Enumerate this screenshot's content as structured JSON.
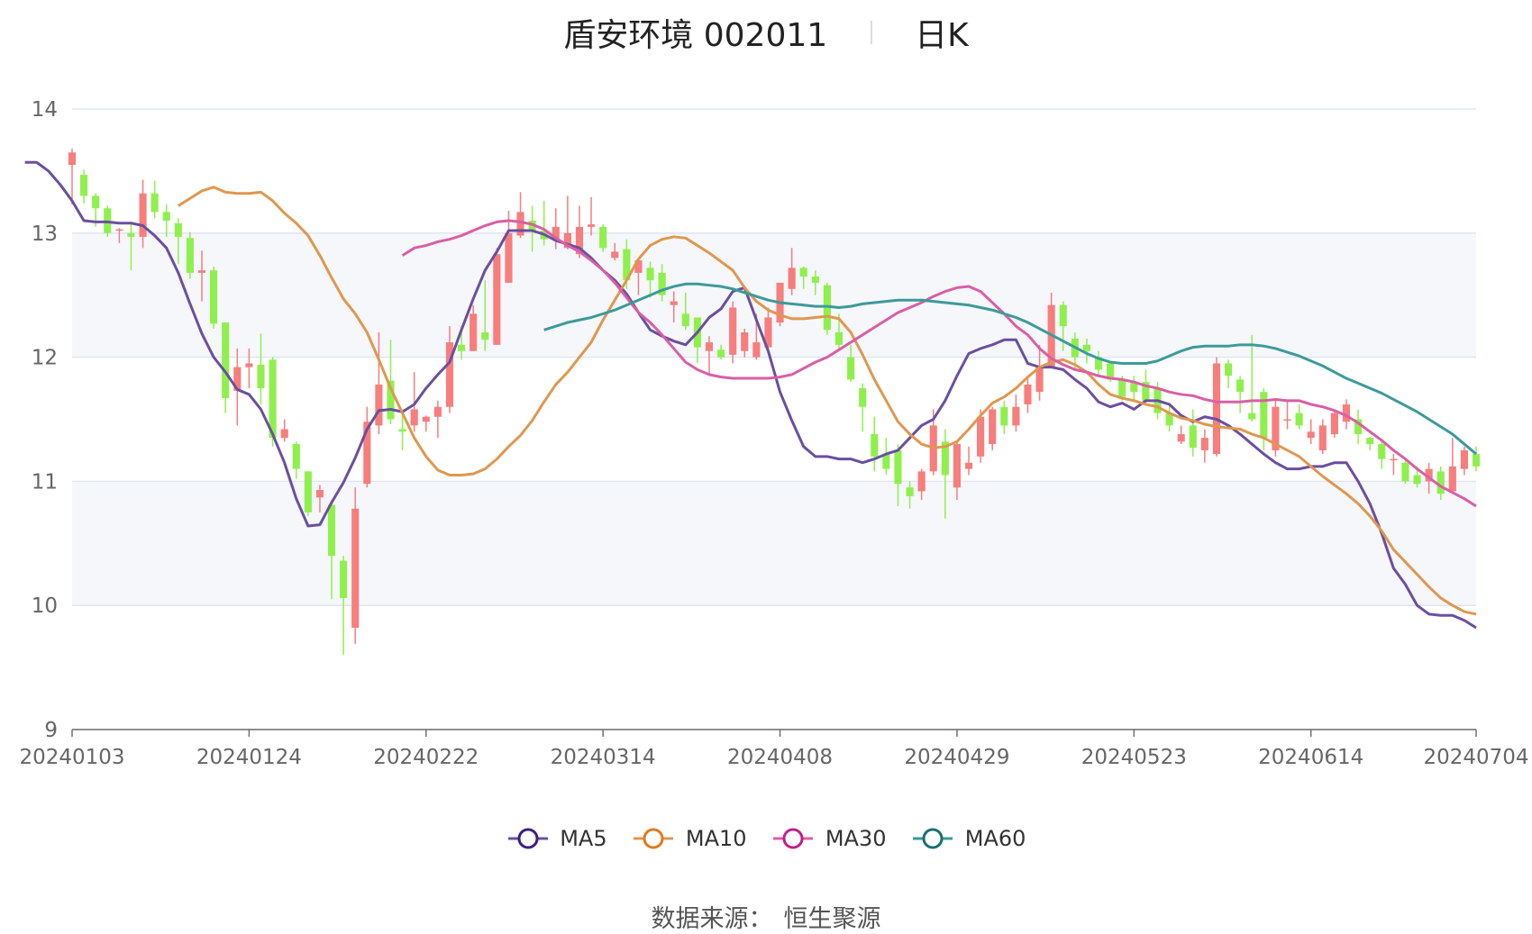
{
  "title": {
    "name": "盾安环境 002011",
    "period": "日K"
  },
  "source": {
    "label": "数据来源：",
    "value": "恒生聚源"
  },
  "chart_data": {
    "type": "candlestick",
    "y_range": [
      9,
      14
    ],
    "y_ticks": [
      9,
      10,
      11,
      12,
      13,
      14
    ],
    "x_tick_labels": [
      "20240103",
      "20240124",
      "20240222",
      "20240314",
      "20240408",
      "20240429",
      "20240523",
      "20240614",
      "20240704"
    ],
    "x_tick_indices": [
      0,
      15,
      30,
      45,
      60,
      75,
      90,
      105,
      119
    ],
    "candle_count": 120,
    "colors": {
      "up": "#f87d7d",
      "down": "#8ff04d",
      "grid": "#e1e6f2",
      "band": "#f5f7fb",
      "axis": "#666666"
    },
    "candles": [
      [
        13.55,
        13.65,
        13.68,
        13.23
      ],
      [
        13.47,
        13.3,
        13.51,
        13.24
      ],
      [
        13.3,
        13.2,
        13.32,
        13.05
      ],
      [
        13.2,
        13.0,
        13.22,
        12.97
      ],
      [
        13.02,
        13.03,
        13.04,
        12.92
      ],
      [
        13.0,
        12.97,
        13.08,
        12.7
      ],
      [
        12.97,
        13.32,
        13.43,
        12.88
      ],
      [
        13.32,
        13.17,
        13.42,
        13.12
      ],
      [
        13.17,
        13.1,
        13.23,
        12.97
      ],
      [
        13.08,
        12.97,
        13.12,
        12.75
      ],
      [
        12.96,
        12.68,
        13.01,
        12.63
      ],
      [
        12.68,
        12.7,
        12.86,
        12.45
      ],
      [
        12.7,
        12.27,
        12.73,
        12.23
      ],
      [
        12.28,
        11.67,
        12.28,
        11.55
      ],
      [
        11.73,
        11.92,
        12.07,
        11.45
      ],
      [
        11.92,
        11.95,
        12.07,
        11.75
      ],
      [
        11.94,
        11.75,
        12.19,
        11.62
      ],
      [
        11.98,
        11.35,
        12.0,
        11.28
      ],
      [
        11.35,
        11.42,
        11.5,
        11.32
      ],
      [
        11.3,
        11.1,
        11.32,
        11.02
      ],
      [
        11.08,
        10.75,
        11.08,
        10.72
      ],
      [
        10.87,
        10.93,
        10.97,
        10.75
      ],
      [
        10.81,
        10.4,
        10.85,
        10.05
      ],
      [
        10.36,
        10.06,
        10.4,
        9.6
      ],
      [
        9.82,
        10.78,
        10.95,
        9.69
      ],
      [
        10.98,
        11.48,
        11.6,
        10.95
      ],
      [
        11.45,
        11.78,
        12.2,
        11.38
      ],
      [
        11.81,
        11.5,
        12.14,
        11.46
      ],
      [
        11.42,
        11.4,
        11.58,
        11.25
      ],
      [
        11.45,
        11.58,
        11.88,
        11.4
      ],
      [
        11.48,
        11.52,
        11.53,
        11.4
      ],
      [
        11.52,
        11.6,
        11.65,
        11.35
      ],
      [
        11.6,
        12.12,
        12.25,
        11.55
      ],
      [
        12.1,
        12.05,
        12.25,
        11.98
      ],
      [
        12.05,
        12.35,
        12.42,
        12.05
      ],
      [
        12.2,
        12.14,
        12.62,
        12.05
      ],
      [
        12.1,
        12.83,
        12.88,
        12.1
      ],
      [
        12.6,
        13.0,
        13.18,
        12.6
      ],
      [
        12.98,
        13.17,
        13.33,
        12.96
      ],
      [
        13.1,
        13.02,
        13.22,
        12.85
      ],
      [
        13.02,
        12.95,
        13.26,
        12.9
      ],
      [
        12.95,
        13.05,
        13.2,
        12.87
      ],
      [
        12.88,
        13.0,
        13.3,
        12.87
      ],
      [
        12.83,
        13.05,
        13.22,
        12.8
      ],
      [
        13.05,
        13.07,
        13.29,
        12.98
      ],
      [
        13.05,
        12.88,
        13.07,
        12.85
      ],
      [
        12.8,
        12.85,
        12.92,
        12.78
      ],
      [
        12.87,
        12.62,
        12.95,
        12.55
      ],
      [
        12.68,
        12.78,
        12.8,
        12.5
      ],
      [
        12.72,
        12.62,
        12.77,
        12.48
      ],
      [
        12.68,
        12.5,
        12.75,
        12.45
      ],
      [
        12.42,
        12.45,
        12.53,
        12.28
      ],
      [
        12.35,
        12.25,
        12.52,
        12.22
      ],
      [
        12.32,
        12.08,
        12.32,
        11.95
      ],
      [
        12.05,
        12.12,
        12.17,
        11.85
      ],
      [
        12.06,
        12.0,
        12.1,
        11.98
      ],
      [
        12.02,
        12.4,
        12.45,
        11.95
      ],
      [
        12.05,
        12.2,
        12.23,
        12.0
      ],
      [
        12.0,
        12.12,
        12.35,
        11.98
      ],
      [
        12.08,
        12.32,
        12.4,
        12.05
      ],
      [
        12.28,
        12.6,
        12.6,
        12.25
      ],
      [
        12.55,
        12.72,
        12.88,
        12.5
      ],
      [
        12.72,
        12.65,
        12.73,
        12.55
      ],
      [
        12.65,
        12.6,
        12.7,
        12.5
      ],
      [
        12.58,
        12.22,
        12.6,
        12.18
      ],
      [
        12.2,
        12.1,
        12.35,
        12.05
      ],
      [
        12.0,
        11.82,
        12.1,
        11.8
      ],
      [
        11.75,
        11.6,
        11.79,
        11.4
      ],
      [
        11.38,
        11.2,
        11.52,
        11.08
      ],
      [
        11.22,
        11.1,
        11.35,
        11.05
      ],
      [
        11.25,
        10.98,
        11.3,
        10.8
      ],
      [
        10.95,
        10.88,
        11.0,
        10.78
      ],
      [
        10.92,
        11.08,
        11.1,
        10.85
      ],
      [
        11.08,
        11.45,
        11.58,
        11.05
      ],
      [
        11.32,
        11.05,
        11.42,
        10.7
      ],
      [
        10.95,
        11.3,
        11.33,
        10.85
      ],
      [
        11.1,
        11.15,
        11.28,
        11.05
      ],
      [
        11.2,
        11.52,
        11.58,
        11.15
      ],
      [
        11.3,
        11.58,
        11.6,
        11.25
      ],
      [
        11.6,
        11.45,
        11.65,
        11.38
      ],
      [
        11.45,
        11.6,
        11.7,
        11.4
      ],
      [
        11.62,
        11.78,
        11.85,
        11.55
      ],
      [
        11.72,
        11.92,
        12.1,
        11.65
      ],
      [
        11.92,
        12.42,
        12.52,
        11.92
      ],
      [
        12.42,
        12.25,
        12.45,
        12.05
      ],
      [
        12.15,
        12.0,
        12.2,
        11.9
      ],
      [
        12.1,
        12.05,
        12.15,
        11.95
      ],
      [
        12.0,
        11.9,
        12.05,
        11.85
      ],
      [
        11.95,
        11.82,
        11.95,
        11.8
      ],
      [
        11.82,
        11.68,
        11.85,
        11.65
      ],
      [
        11.8,
        11.72,
        11.85,
        11.65
      ],
      [
        11.8,
        11.65,
        11.9,
        11.63
      ],
      [
        11.75,
        11.55,
        11.8,
        11.5
      ],
      [
        11.55,
        11.45,
        11.62,
        11.4
      ],
      [
        11.32,
        11.38,
        11.45,
        11.3
      ],
      [
        11.45,
        11.27,
        11.58,
        11.2
      ],
      [
        11.25,
        11.35,
        11.42,
        11.15
      ],
      [
        11.22,
        11.95,
        12.0,
        11.2
      ],
      [
        11.95,
        11.85,
        11.98,
        11.75
      ],
      [
        11.82,
        11.72,
        11.85,
        11.55
      ],
      [
        11.55,
        11.5,
        12.18,
        11.48
      ],
      [
        11.72,
        11.35,
        11.75,
        11.25
      ],
      [
        11.25,
        11.6,
        11.65,
        11.2
      ],
      [
        11.5,
        11.5,
        11.65,
        11.42
      ],
      [
        11.55,
        11.45,
        11.62,
        11.42
      ],
      [
        11.35,
        11.4,
        11.5,
        11.3
      ],
      [
        11.25,
        11.45,
        11.5,
        11.22
      ],
      [
        11.38,
        11.55,
        11.58,
        11.35
      ],
      [
        11.48,
        11.62,
        11.66,
        11.42
      ],
      [
        11.5,
        11.38,
        11.58,
        11.3
      ],
      [
        11.35,
        11.3,
        11.36,
        11.25
      ],
      [
        11.3,
        11.18,
        11.32,
        11.1
      ],
      [
        11.18,
        11.18,
        11.22,
        11.05
      ],
      [
        11.15,
        11.0,
        11.18,
        10.98
      ],
      [
        11.05,
        10.98,
        11.12,
        10.95
      ],
      [
        11.0,
        11.1,
        11.15,
        10.9
      ],
      [
        11.08,
        10.9,
        11.12,
        10.85
      ],
      [
        10.92,
        11.12,
        11.35,
        10.9
      ],
      [
        11.1,
        11.25,
        11.28,
        11.05
      ],
      [
        11.22,
        11.12,
        11.28,
        11.08
      ]
    ],
    "series": [
      {
        "name": "MA5",
        "color": "#6a4fa0",
        "legend_color": "#3c1f82",
        "values": [
          13.57,
          13.57,
          13.5,
          13.39,
          13.26,
          13.1,
          13.09,
          13.09,
          13.08,
          13.08,
          13.06,
          12.98,
          12.88,
          12.68,
          12.43,
          12.19,
          12.0,
          11.88,
          11.74,
          11.7,
          11.58,
          11.38,
          11.15,
          10.86,
          10.64,
          10.65,
          10.83,
          10.99,
          11.19,
          11.42,
          11.57,
          11.58,
          11.56,
          11.62,
          11.75,
          11.86,
          11.96,
          12.22,
          12.47,
          12.7,
          12.85,
          13.02,
          13.02,
          13.02,
          12.99,
          12.94,
          12.91,
          12.88,
          12.8,
          12.7,
          12.62,
          12.51,
          12.36,
          12.22,
          12.17,
          12.13,
          12.1,
          12.2,
          12.32,
          12.39,
          12.53,
          12.56,
          12.3,
          12.05,
          11.72,
          11.49,
          11.28,
          11.2,
          11.2,
          11.18,
          11.18,
          11.15,
          11.18,
          11.22,
          11.25,
          11.35,
          11.45,
          11.5,
          11.65,
          11.85,
          12.03,
          12.07,
          12.1,
          12.14,
          12.14,
          11.95,
          11.92,
          11.92,
          11.9,
          11.82,
          11.75,
          11.64,
          11.6,
          11.63,
          11.58,
          11.65,
          11.65,
          11.62,
          11.53,
          11.48,
          11.52,
          11.5,
          11.45,
          11.38,
          11.3,
          11.22,
          11.15,
          11.1,
          11.1,
          11.12,
          11.12,
          11.15,
          11.15,
          11.0,
          10.82,
          10.58,
          10.3,
          10.17,
          10.0,
          9.93,
          9.92,
          9.92,
          9.88,
          9.82
        ]
      },
      {
        "name": "MA10",
        "color": "#e0974e",
        "legend_color": "#e07a1e",
        "values": [
          13.22,
          13.28,
          13.34,
          13.37,
          13.33,
          13.32,
          13.32,
          13.33,
          13.26,
          13.16,
          13.08,
          12.98,
          12.82,
          12.64,
          12.47,
          12.35,
          12.2,
          11.98,
          11.75,
          11.55,
          11.35,
          11.2,
          11.09,
          11.05,
          11.05,
          11.06,
          11.1,
          11.18,
          11.28,
          11.37,
          11.49,
          11.64,
          11.78,
          11.88,
          12.0,
          12.12,
          12.3,
          12.46,
          12.62,
          12.79,
          12.9,
          12.95,
          12.97,
          12.96,
          12.9,
          12.84,
          12.77,
          12.7,
          12.56,
          12.45,
          12.38,
          12.34,
          12.31,
          12.31,
          12.32,
          12.33,
          12.31,
          12.2,
          12.02,
          11.82,
          11.65,
          11.48,
          11.38,
          11.3,
          11.27,
          11.28,
          11.32,
          11.42,
          11.53,
          11.63,
          11.68,
          11.75,
          11.84,
          11.92,
          11.96,
          11.98,
          11.94,
          11.88,
          11.78,
          11.7,
          11.67,
          11.65,
          11.62,
          11.6,
          11.55,
          11.51,
          11.49,
          11.46,
          11.44,
          11.43,
          11.42,
          11.38,
          11.35,
          11.3,
          11.25,
          11.2,
          11.12,
          11.04,
          10.97,
          10.9,
          10.82,
          10.72,
          10.6,
          10.45,
          10.35,
          10.25,
          10.15,
          10.06,
          10.0,
          9.95,
          9.93
        ]
      },
      {
        "name": "MA30",
        "color": "#da5ea6",
        "legend_color": "#c0208a",
        "values": [
          12.82,
          12.88,
          12.9,
          12.93,
          12.95,
          12.98,
          13.02,
          13.06,
          13.09,
          13.1,
          13.09,
          13.07,
          13.03,
          12.96,
          12.9,
          12.85,
          12.78,
          12.7,
          12.6,
          12.48,
          12.36,
          12.28,
          12.18,
          12.07,
          11.96,
          11.9,
          11.86,
          11.84,
          11.83,
          11.83,
          11.83,
          11.83,
          11.84,
          11.86,
          11.91,
          11.96,
          12.0,
          12.06,
          12.12,
          12.18,
          12.24,
          12.3,
          12.36,
          12.4,
          12.44,
          12.49,
          12.53,
          12.56,
          12.57,
          12.53,
          12.44,
          12.35,
          12.25,
          12.18,
          12.07,
          11.99,
          11.94,
          11.9,
          11.88,
          11.85,
          11.83,
          11.82,
          11.8,
          11.77,
          11.75,
          11.72,
          11.7,
          11.69,
          11.66,
          11.64,
          11.64,
          11.64,
          11.65,
          11.65,
          11.66,
          11.65,
          11.65,
          11.62,
          11.6,
          11.57,
          11.53,
          11.47,
          11.4,
          11.33,
          11.25,
          11.18,
          11.1,
          11.03,
          10.96,
          10.91,
          10.86,
          10.8
        ]
      },
      {
        "name": "MA60",
        "color": "#3d9a9a",
        "legend_color": "#1a6f72",
        "values": [
          12.22,
          12.25,
          12.28,
          12.3,
          12.32,
          12.35,
          12.38,
          12.42,
          12.46,
          12.5,
          12.54,
          12.57,
          12.59,
          12.59,
          12.58,
          12.57,
          12.55,
          12.52,
          12.49,
          12.46,
          12.44,
          12.43,
          12.42,
          12.41,
          12.41,
          12.4,
          12.41,
          12.43,
          12.44,
          12.45,
          12.46,
          12.46,
          12.46,
          12.45,
          12.44,
          12.43,
          12.42,
          12.4,
          12.38,
          12.35,
          12.32,
          12.28,
          12.23,
          12.18,
          12.13,
          12.08,
          12.03,
          11.99,
          11.96,
          11.95,
          11.95,
          11.95,
          11.97,
          12.01,
          12.05,
          12.08,
          12.09,
          12.09,
          12.09,
          12.1,
          12.1,
          12.09,
          12.07,
          12.04,
          12.01,
          11.97,
          11.93,
          11.88,
          11.83,
          11.79,
          11.75,
          11.71,
          11.66,
          11.61,
          11.56,
          11.5,
          11.44,
          11.38,
          11.3,
          11.22
        ]
      }
    ]
  }
}
